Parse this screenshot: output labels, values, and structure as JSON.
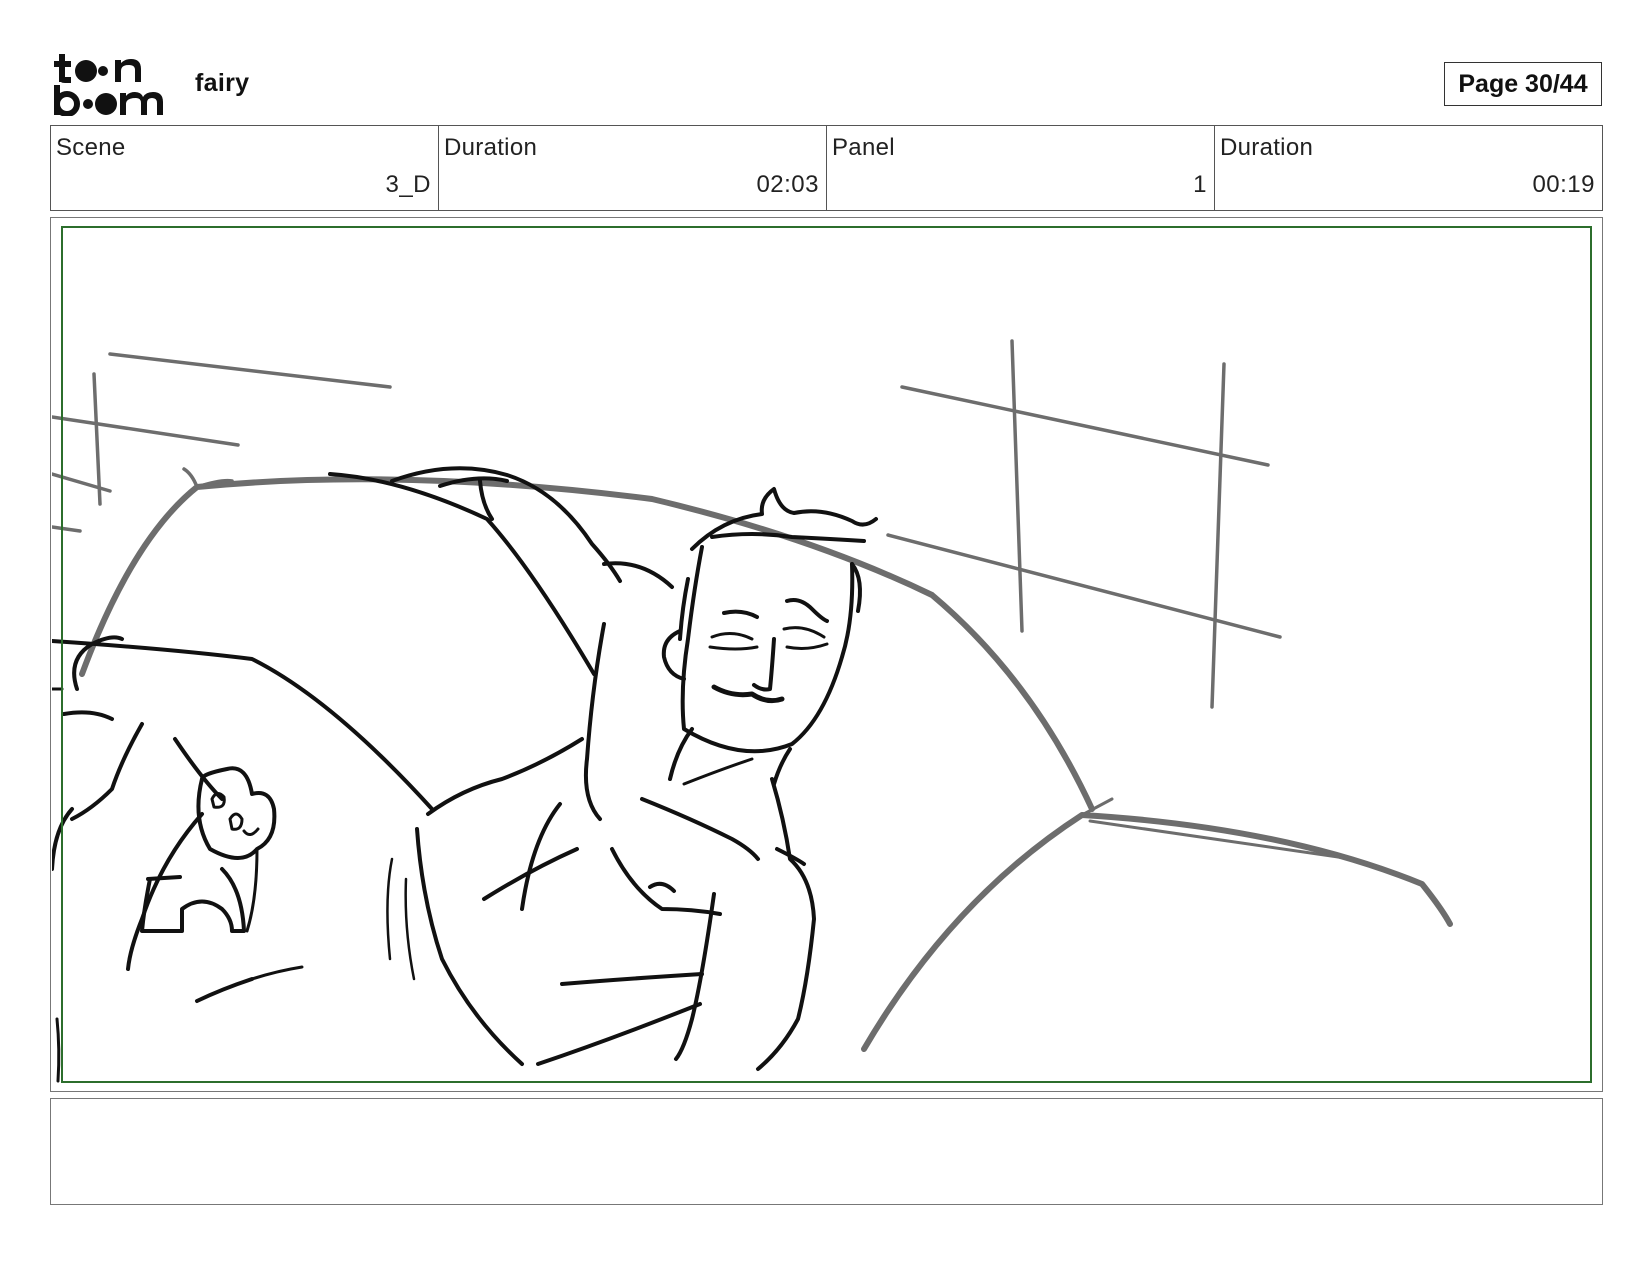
{
  "header": {
    "logo_text": "toon boom",
    "project": "fairy",
    "page": "Page 30/44"
  },
  "info": [
    {
      "label": "Scene",
      "value": "3_D"
    },
    {
      "label": "Duration",
      "value": "02:03"
    },
    {
      "label": "Panel",
      "value": "1"
    },
    {
      "label": "Duration",
      "value": "00:19"
    }
  ],
  "notes": ""
}
